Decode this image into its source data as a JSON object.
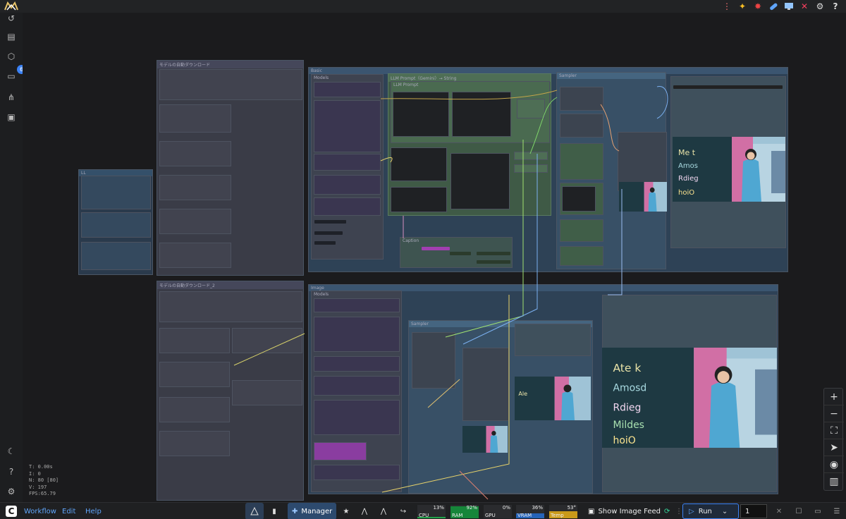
{
  "topbar": {
    "logo_icon": "comfy-logo-icon",
    "right_icons": [
      "menu-dots-icon",
      "sparkle-icon",
      "star-burst-icon",
      "pill-icon",
      "monitor-icon",
      "close-x-icon",
      "gear-icon",
      "help-icon"
    ]
  },
  "sidebar": {
    "items": [
      "history-icon",
      "document-icon",
      "cube-icon",
      "queue-icon",
      "hierarchy-icon",
      "image-icon"
    ],
    "queue_badge": "6",
    "bottom_items": [
      "moon-icon",
      "help-circle-icon",
      "settings-icon"
    ]
  },
  "canvas": {
    "groups": [
      {
        "title": "モデルの自動ダウンロード"
      },
      {
        "title": "モデルの自動ダウンロード_2"
      },
      {
        "title": "LL"
      },
      {
        "title": "Basic"
      },
      {
        "title": "Models"
      },
      {
        "title": "LLM Prompt（Gemini）→ String"
      },
      {
        "title": "LLM Prompt"
      },
      {
        "title": "Sampler"
      },
      {
        "title": "Caption"
      },
      {
        "title": "Image"
      },
      {
        "title": "Models"
      },
      {
        "title": "Sampler"
      }
    ],
    "stats": {
      "t": "T: 0.00s",
      "i": "I: 0",
      "n": "N: 80 [80]",
      "v": "V: 197",
      "fps": "FPS:65.79"
    }
  },
  "zoom_controls": [
    "zoom-in-icon",
    "zoom-out-icon",
    "fit-view-icon",
    "locate-icon",
    "visibility-icon",
    "minimap-icon"
  ],
  "bottombar": {
    "logo_icon": "comfy-c-icon",
    "menus": [
      "Workflow",
      "Edit",
      "Help"
    ],
    "manager_label": "Manager",
    "meters": [
      {
        "label": "CPU",
        "value": "13%",
        "fill": 0.13,
        "color": "#22a34a"
      },
      {
        "label": "RAM",
        "value": "92%",
        "fill": 0.92,
        "color": "#16863a"
      },
      {
        "label": "GPU",
        "value": "0%",
        "fill": 0.0,
        "color": "#22a34a"
      },
      {
        "label": "VRAM",
        "value": "36%",
        "fill": 0.36,
        "color": "#2563b8"
      },
      {
        "label": "Temp",
        "value": "53°",
        "fill": 0.53,
        "color": "#ca9a1a"
      }
    ],
    "show_image_feed": "Show Image Feed",
    "run_label": "Run",
    "batch_count": "1"
  },
  "colors": {
    "accent_blue": "#3b82f6",
    "group_blue": "#3b5570",
    "group_green": "#3e5e45",
    "group_gray": "#3a3c45"
  }
}
